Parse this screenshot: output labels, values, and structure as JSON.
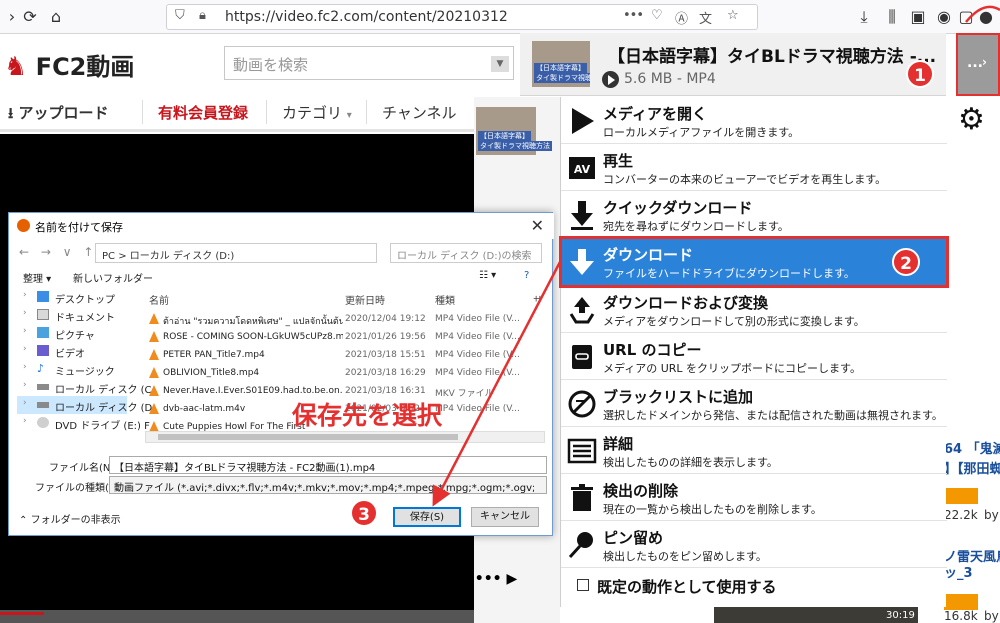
{
  "browser": {
    "url": "https://video.fc2.com/content/20210312",
    "menu_dots": "•••"
  },
  "site": {
    "logo_text": "FC2動画",
    "search_placeholder": "動画を検索",
    "nav": {
      "upload": "アップロード",
      "premium": "有料会員登録",
      "category": "カテゴリ",
      "channel": "チャンネル"
    }
  },
  "popup": {
    "media": {
      "thumb_line1": "【日本語字幕】",
      "thumb_line2": "タイ製ドラマ視聴方法",
      "title": "【日本語字幕】タイBLドラマ視聴方法 -...",
      "size": "5.6 MB - MP4"
    },
    "menu": [
      {
        "title": "メディアを開く",
        "desc": "ローカルメディアファイルを開きます。",
        "icon": "play-icon"
      },
      {
        "title": "再生",
        "desc": "コンバーターの本来のビューアーでビデオを再生します。",
        "icon": "av-icon"
      },
      {
        "title": "クイックダウンロード",
        "desc": "宛先を尋ねずにダウンロードします。",
        "icon": "quick-download-icon"
      },
      {
        "title": "ダウンロード",
        "desc": "ファイルをハードドライブにダウンロードします。",
        "icon": "download-icon"
      },
      {
        "title": "ダウンロードおよび変換",
        "desc": "メディアをダウンロードして別の形式に変換します。",
        "icon": "recycle-icon"
      },
      {
        "title": "URL のコピー",
        "desc": "メディアの URL をクリップボードにコピーします。",
        "icon": "link-icon"
      },
      {
        "title": "ブラックリストに追加",
        "desc": "選択したドメインから発信、または配信された動画は無視されます。",
        "icon": "blacklist-icon"
      },
      {
        "title": "詳細",
        "desc": "検出したものの詳細を表示します。",
        "icon": "details-icon"
      },
      {
        "title": "検出の削除",
        "desc": "現在の一覧から検出したものを削除します。",
        "icon": "trash-icon"
      },
      {
        "title": "ピン留め",
        "desc": "検出したものをピン留めします。",
        "icon": "pin-icon"
      }
    ],
    "default_action": "既定の動作として使用する",
    "more_label": "...",
    "dots_label": "•••"
  },
  "annotations": {
    "badge1": "1",
    "badge2": "2",
    "badge3": "3",
    "select_destination": "保存先を選択"
  },
  "right_page": {
    "line1": "64 「鬼滅",
    "line2": "】【那田蜘",
    "views1": "22.2k",
    "by1": "by",
    "line3": "ノ雷天風鳥",
    "line4": "ッ_3",
    "views2": "16.8k",
    "by2": "by",
    "duration": "30:19"
  },
  "dialog": {
    "title": "名前を付けて保存",
    "address": "PC  >  ローカル ディスク (D:)",
    "search_placeholder": "ローカル ディスク (D:)の検索",
    "organize": "整理 ▾",
    "new_folder": "新しいフォルダー",
    "tree": [
      {
        "label": "デスクトップ",
        "selected": false
      },
      {
        "label": "ドキュメント",
        "selected": false
      },
      {
        "label": "ピクチャ",
        "selected": false
      },
      {
        "label": "ビデオ",
        "selected": false
      },
      {
        "label": "ミュージック",
        "selected": false
      },
      {
        "label": "ローカル ディスク (C",
        "selected": false
      },
      {
        "label": "ローカル ディスク (D",
        "selected": true
      },
      {
        "label": "DVD ドライブ (E:) F",
        "selected": false
      }
    ],
    "columns": {
      "name": "名前",
      "date": "更新日時",
      "type": "種類",
      "size": "サ"
    },
    "files": [
      {
        "name": "ต้าอ่าน \"รวมความโดดหพิเศษ\" _ แปลจักนั้นต้นจี...",
        "date": "2020/12/04 19:12",
        "type": "MP4 Video File (V..."
      },
      {
        "name": "ROSÉ - COMING SOON-LGkUW5cUPz8.m...",
        "date": "2021/01/26 19:56",
        "type": "MP4 Video File (V..."
      },
      {
        "name": "PETER PAN_Title7.mp4",
        "date": "2021/03/18 15:51",
        "type": "MP4 Video File (V..."
      },
      {
        "name": "OBLIVION_Title8.mp4",
        "date": "2021/03/18 16:29",
        "type": "MP4 Video File (V..."
      },
      {
        "name": "Never.Have.I.Ever.S01E09.had.to.be.on.m...",
        "date": "2021/03/18 16:31",
        "type": "MKV ファイル"
      },
      {
        "name": "dvb-aac-latm.m4v",
        "date": "2021/02/03 9:52",
        "type": "MP4 Video File (V..."
      },
      {
        "name": "Cute Puppies Howl For The First",
        "date": "",
        "type": ""
      }
    ],
    "filename_label": "ファイル名(N):",
    "filename_value": "【日本語字幕】タイBLドラマ視聴方法 - FC2動画(1).mp4",
    "filetype_label": "ファイルの種類(T):",
    "filetype_value": "動画ファイル (*.avi;*.divx;*.flv;*.m4v;*.mkv;*.mov;*.mp4;*.mpeg;*.mpg;*.ogm;*.ogv;*.ogx;*.rm;*.rmvb;*.smil;",
    "hide_folders": "フォルダーの非表示",
    "save_button": "保存(S)",
    "cancel_button": "キャンセル"
  }
}
